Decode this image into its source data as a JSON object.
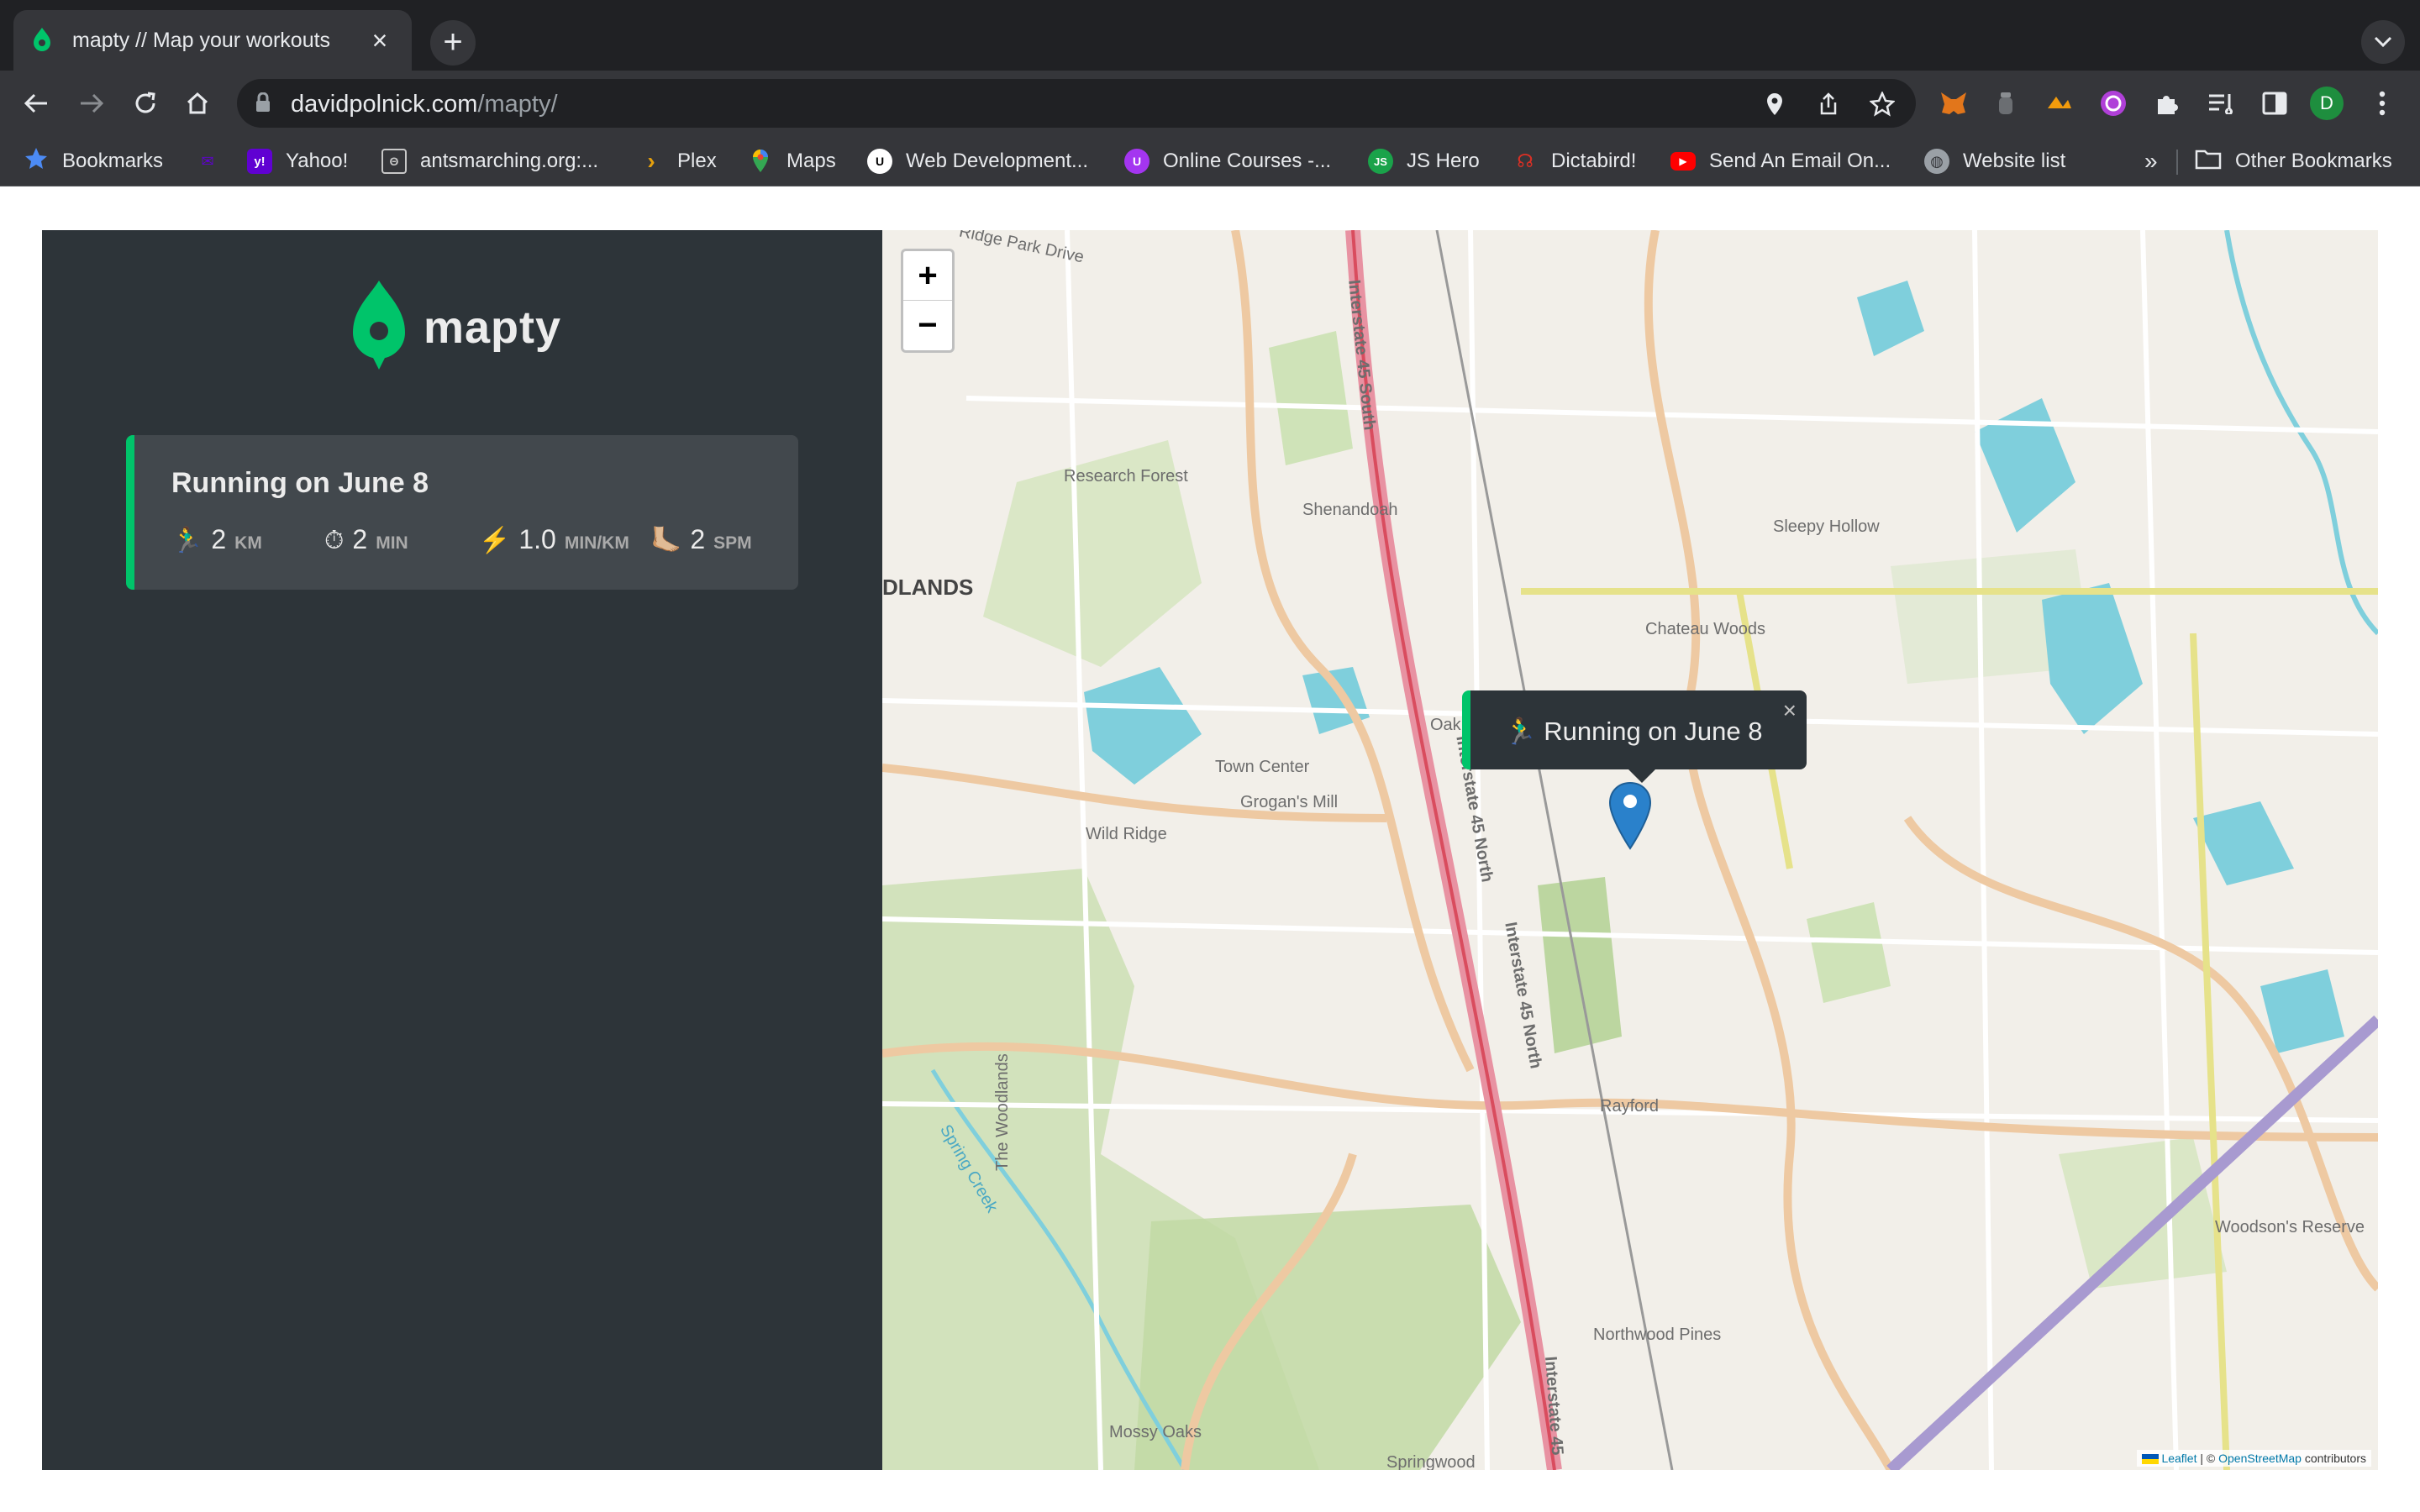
{
  "browser": {
    "tab_title": "mapty // Map your workouts",
    "url_domain": "davidpolnick.com",
    "url_path": "/mapty/",
    "profile_initial": "D",
    "bookmarks": [
      {
        "label": "Bookmarks",
        "icon": "star-icon",
        "color": "#4c8bf5"
      },
      {
        "label": "",
        "icon": "yahoo-mail-icon",
        "color": "#5f01d1"
      },
      {
        "label": "Yahoo!",
        "icon": "yahoo-icon",
        "color": "#6001d2"
      },
      {
        "label": "antsmarching.org:...",
        "icon": "antsmarching-icon",
        "color": "#9aa0a6"
      },
      {
        "label": "Plex",
        "icon": "plex-icon",
        "color": "#e5a00d"
      },
      {
        "label": "Maps",
        "icon": "maps-icon",
        "color": "#34a853"
      },
      {
        "label": "Web Development...",
        "icon": "udemy-icon",
        "color": "#ffffff"
      },
      {
        "label": "Online Courses -...",
        "icon": "udemy-icon",
        "color": "#a435f0"
      },
      {
        "label": "JS Hero",
        "icon": "jshero-icon",
        "color": "#1aa34a"
      },
      {
        "label": "Dictabird!",
        "icon": "dictabird-icon",
        "color": "#d93025"
      },
      {
        "label": "Send An Email On...",
        "icon": "youtube-icon",
        "color": "#ff0000"
      },
      {
        "label": "Website list",
        "icon": "globe-icon",
        "color": "#9aa0a6"
      }
    ],
    "more_bookmarks": "»",
    "other_bookmarks": "Other Bookmarks"
  },
  "app": {
    "logo_text": "mapty",
    "brand_color": "#00c46a",
    "workouts": [
      {
        "title": "Running on June 8",
        "type": "running",
        "distance_icon": "🏃‍♂️",
        "distance": "2",
        "distance_unit": "KM",
        "duration_icon": "⏱",
        "duration": "2",
        "duration_unit": "MIN",
        "pace_icon": "⚡️",
        "pace": "1.0",
        "pace_unit": "MIN/KM",
        "cadence_icon": "🦶🏼",
        "cadence": "2",
        "cadence_unit": "SPM"
      }
    ]
  },
  "map": {
    "zoom_in": "+",
    "zoom_out": "−",
    "popup_text": "🏃‍♂️ Running on June 8",
    "popup_close": "×",
    "attribution_leaflet": "Leaflet",
    "attribution_sep": " | © ",
    "attribution_osm": "OpenStreetMap",
    "attribution_suffix": " contributors",
    "labels": [
      "Research Forest",
      "Shenandoah",
      "Sleepy Hollow",
      "DLANDS",
      "Chateau Woods",
      "Town Center",
      "Grogan's Mill",
      "Wild Ridge",
      "Oak",
      "Rayford",
      "The Woodlands",
      "Spring Creek",
      "Woodson's Reserve",
      "Northwood Pines",
      "Mossy Oaks",
      "Springwood",
      "Interstate 45 South",
      "Interstate 45 North",
      "Interstate 45 North",
      "Interstate 45",
      "Ridge Park Drive"
    ]
  }
}
